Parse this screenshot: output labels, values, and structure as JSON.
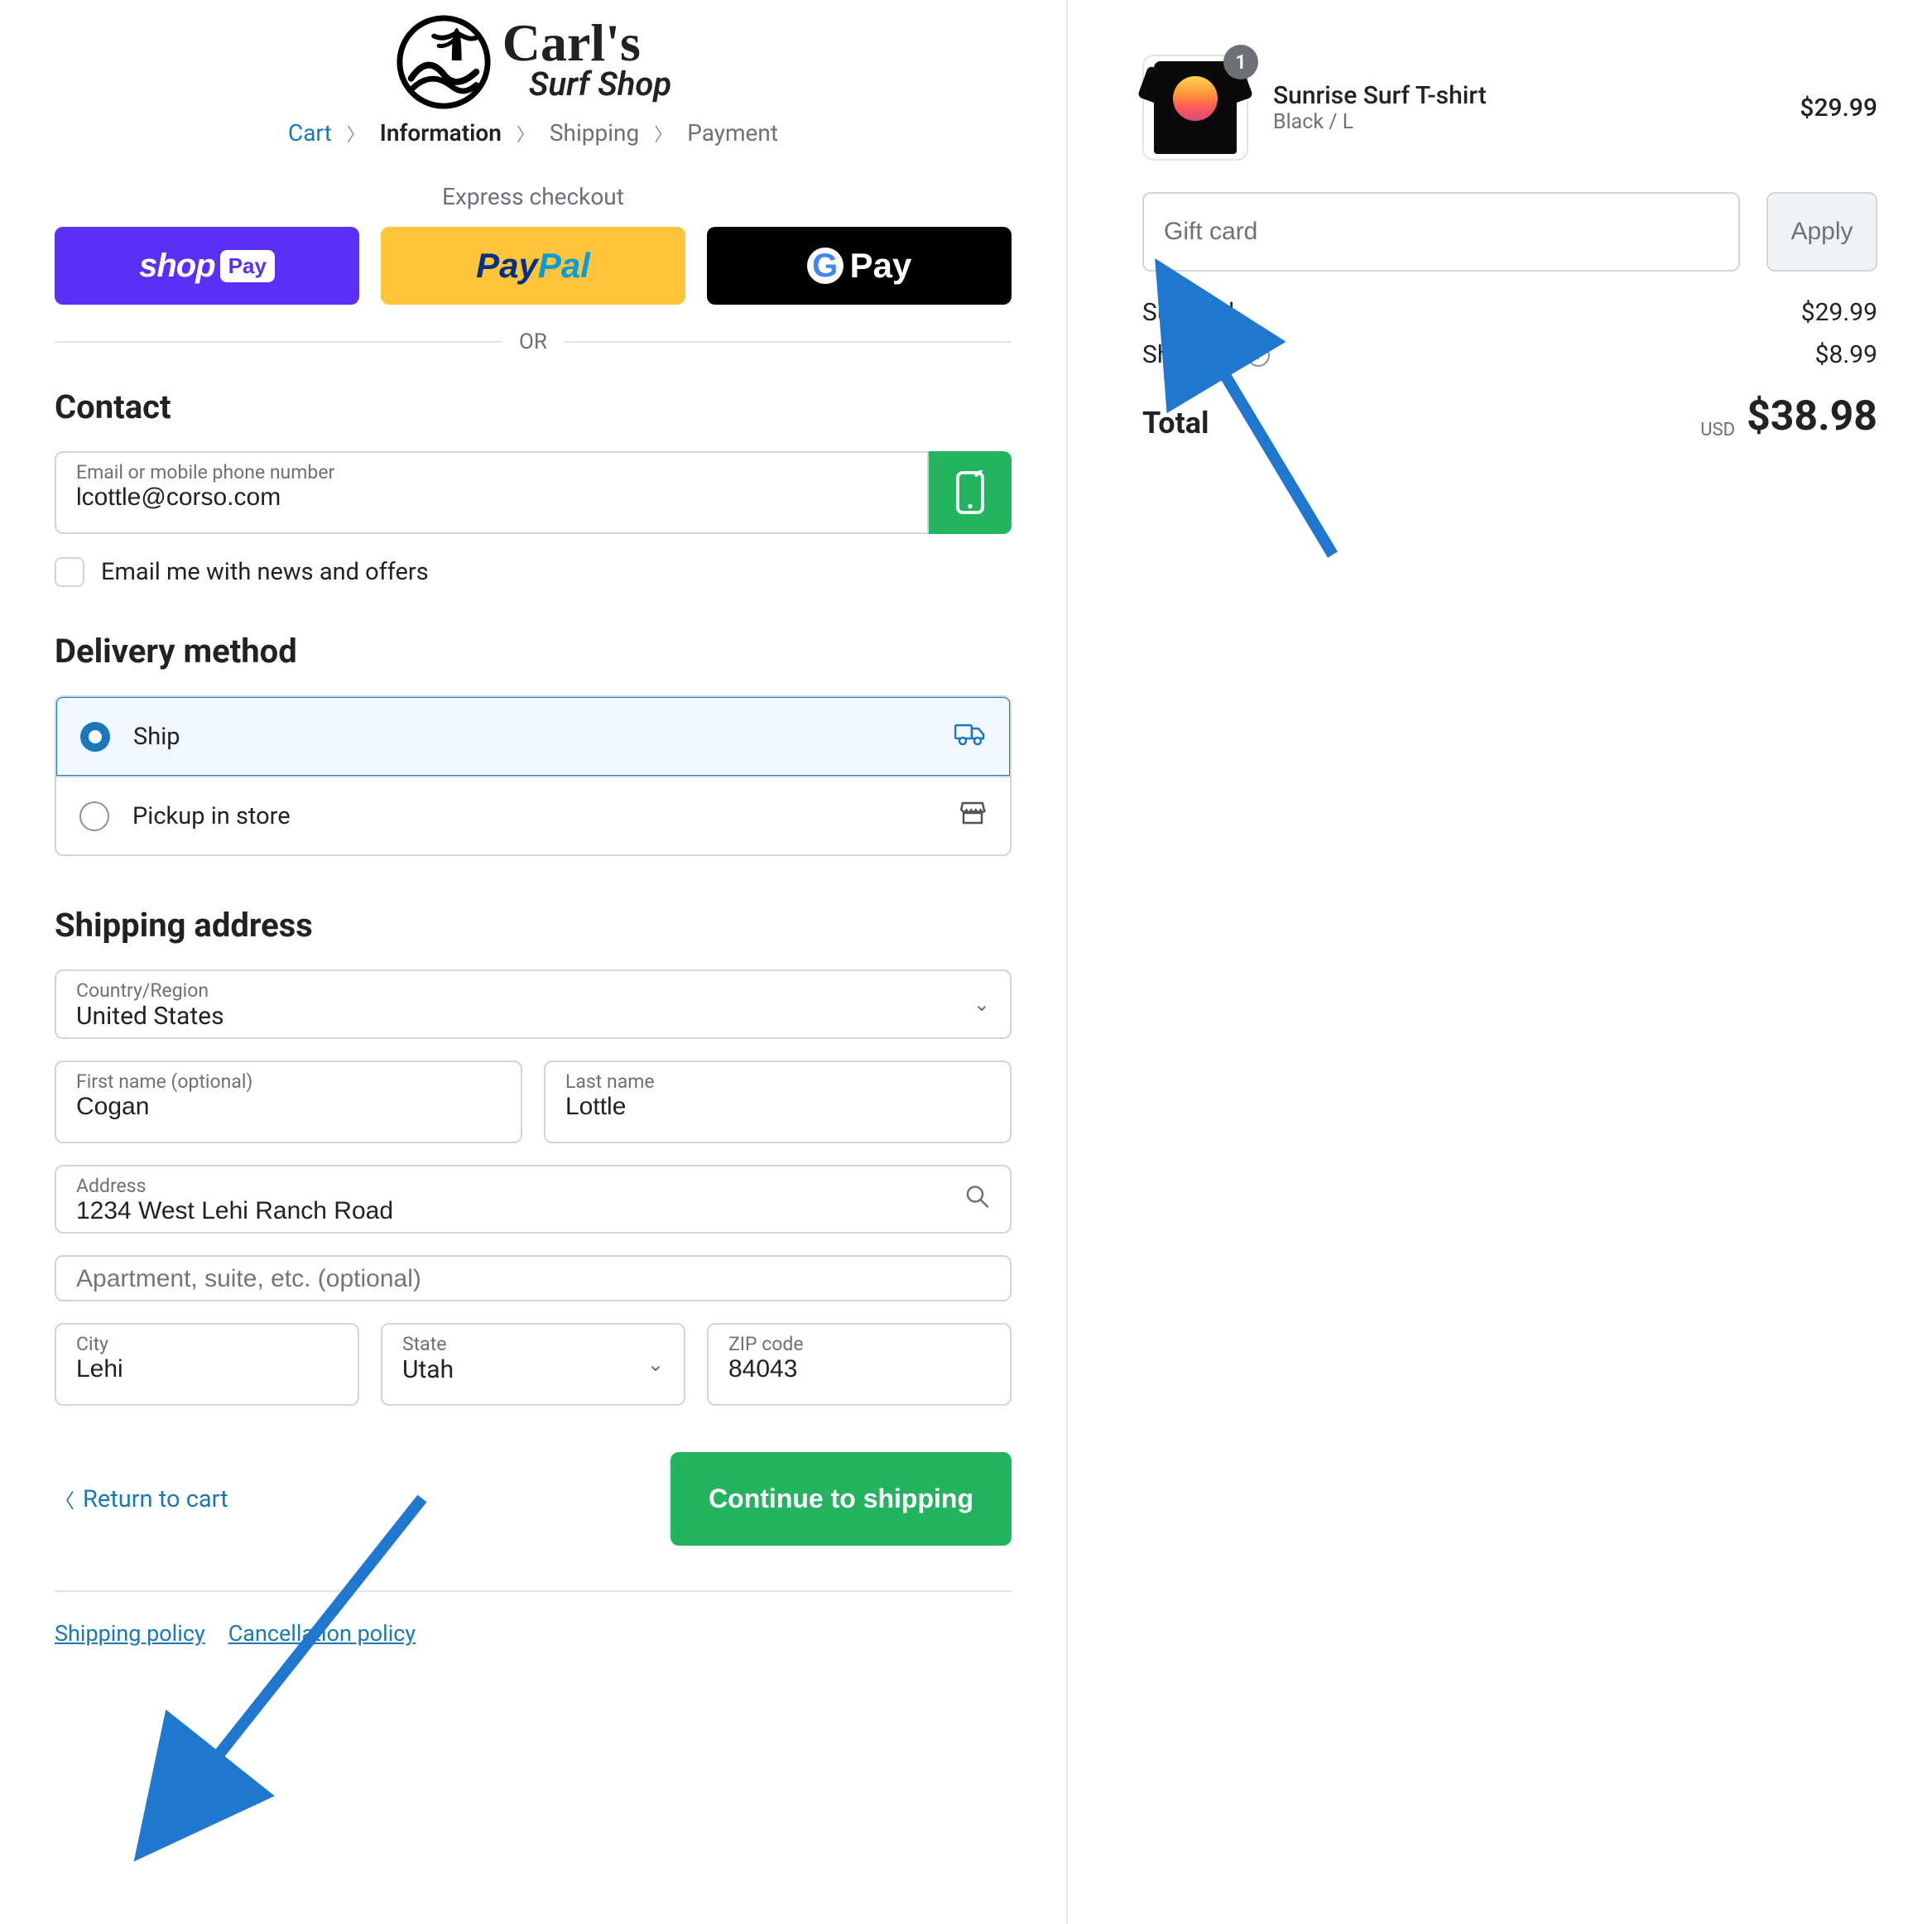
{
  "logo": {
    "name": "Carl's",
    "sub": "Surf Shop"
  },
  "breadcrumb": {
    "cart": "Cart",
    "information": "Information",
    "shipping": "Shipping",
    "payment": "Payment"
  },
  "express": {
    "title": "Express checkout",
    "or": "OR"
  },
  "contact": {
    "heading": "Contact",
    "email_label": "Email or mobile phone number",
    "email_value": "lcottle@corso.com",
    "news_label": "Email me with news and offers"
  },
  "delivery": {
    "heading": "Delivery method",
    "ship": "Ship",
    "pickup": "Pickup in store"
  },
  "address": {
    "heading": "Shipping address",
    "country_label": "Country/Region",
    "country_value": "United States",
    "first_label": "First name (optional)",
    "first_value": "Cogan",
    "last_label": "Last name",
    "last_value": "Lottle",
    "addr_label": "Address",
    "addr_value": "1234 West Lehi Ranch Road",
    "apt_placeholder": "Apartment, suite, etc. (optional)",
    "city_label": "City",
    "city_value": "Lehi",
    "state_label": "State",
    "state_value": "Utah",
    "zip_label": "ZIP code",
    "zip_value": "84043"
  },
  "footer": {
    "return": "Return to cart",
    "continue": "Continue to shipping",
    "shipping_policy": "Shipping policy",
    "cancellation_policy": "Cancellation policy"
  },
  "cart": {
    "item_title": "Sunrise Surf T-shirt",
    "item_variant": "Black / L",
    "item_price": "$29.99",
    "qty": "1",
    "gift_placeholder": "Gift card",
    "apply": "Apply",
    "subtotal_label": "Subtotal",
    "subtotal": "$29.99",
    "shipping_label": "Shipping",
    "shipping": "$8.99",
    "total_label": "Total",
    "currency": "USD",
    "total": "$38.98"
  }
}
